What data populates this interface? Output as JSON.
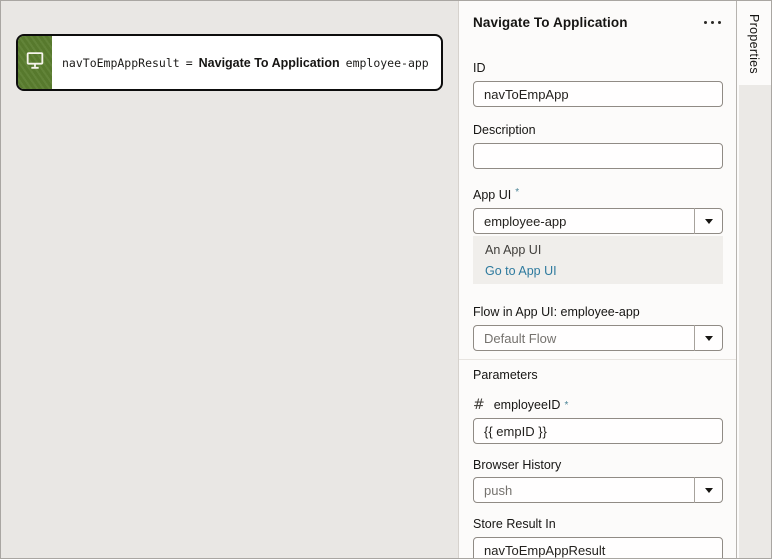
{
  "canvas": {
    "node": {
      "icon": "monitor-icon",
      "result_var": "navToEmpAppResult",
      "equals": "=",
      "action_label": "Navigate To Application",
      "target": "employee-app"
    }
  },
  "panel": {
    "title": "Navigate To Application",
    "menu_icon": "ellipsis-icon",
    "fields": {
      "id": {
        "label": "ID",
        "value": "navToEmpApp"
      },
      "description": {
        "label": "Description",
        "value": ""
      },
      "app_ui": {
        "label": "App UI",
        "required_marker": "*",
        "value": "employee-app",
        "hint_text": "An App UI",
        "link_text": "Go to App UI"
      },
      "flow": {
        "label": "Flow in App UI: employee-app",
        "placeholder": "Default Flow"
      },
      "parameters": {
        "section_label": "Parameters",
        "param_icon": "number-sign-icon",
        "param_name": "employeeID",
        "required_marker": "*",
        "value": "{{ empID }}"
      },
      "browser_history": {
        "label": "Browser History",
        "placeholder": "push"
      },
      "store_result": {
        "label": "Store Result In",
        "value": "navToEmpAppResult"
      }
    }
  },
  "tabs": {
    "properties_label": "Properties"
  },
  "colors": {
    "node_green": "#5a7d2e",
    "link_blue": "#2e7a9e",
    "required_teal": "#4a8396",
    "canvas_bg": "#e9e7e4",
    "panel_bg": "#fcfbfa"
  }
}
